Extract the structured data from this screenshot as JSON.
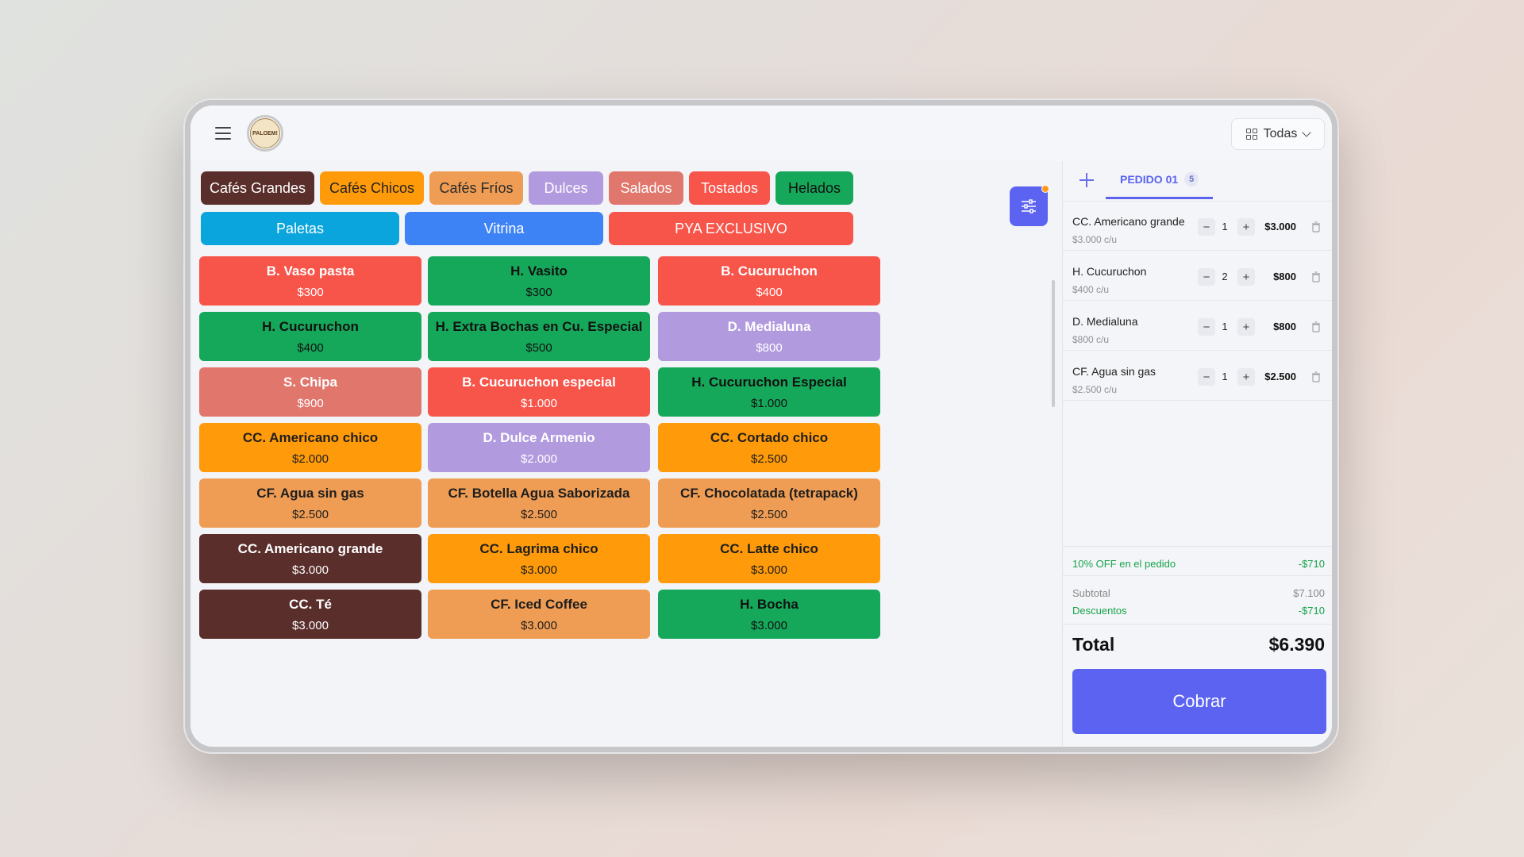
{
  "header": {
    "logo_text": "PALOEM!",
    "view_select_value": "Todas"
  },
  "categories": [
    {
      "label": "Cafés Grandes",
      "bg": "#5a2e2b",
      "fg": "#ffffff"
    },
    {
      "label": "Cafés Chicos",
      "bg": "#ff9a0a",
      "fg": "#222222"
    },
    {
      "label": "Cafés Fríos",
      "bg": "#ef9d54",
      "fg": "#2a2a2a"
    },
    {
      "label": "Dulces",
      "bg": "#b29ade",
      "fg": "#ffffff"
    },
    {
      "label": "Salados",
      "bg": "#e1766c",
      "fg": "#ffffff"
    },
    {
      "label": "Tostados",
      "bg": "#f7544a",
      "fg": "#ffffff"
    },
    {
      "label": "Helados",
      "bg": "#16a85a",
      "fg": "#111111"
    },
    {
      "label": "Paletas",
      "bg": "#0aa5dc",
      "fg": "#ffffff"
    },
    {
      "label": "Vitrina",
      "bg": "#3d83f5",
      "fg": "#ffffff"
    },
    {
      "label": "PYA EXCLUSIVO",
      "bg": "#f7544a",
      "fg": "#ffffff"
    }
  ],
  "products": [
    {
      "name": "B. Vaso pasta",
      "price": "$300",
      "bg": "#f7544a",
      "fg": "#ffffff"
    },
    {
      "name": "H. Vasito",
      "price": "$300",
      "bg": "#16a85a",
      "fg": "#111111"
    },
    {
      "name": "B. Cucuruchon",
      "price": "$400",
      "bg": "#f7544a",
      "fg": "#ffffff"
    },
    {
      "name": "H. Cucuruchon",
      "price": "$400",
      "bg": "#16a85a",
      "fg": "#111111"
    },
    {
      "name": "H. Extra Bochas en Cu. Especial",
      "price": "$500",
      "bg": "#16a85a",
      "fg": "#111111"
    },
    {
      "name": "D. Medialuna",
      "price": "$800",
      "bg": "#b29ade",
      "fg": "#ffffff"
    },
    {
      "name": "S. Chipa",
      "price": "$900",
      "bg": "#e1766c",
      "fg": "#ffffff"
    },
    {
      "name": "B. Cucuruchon especial",
      "price": "$1.000",
      "bg": "#f7544a",
      "fg": "#ffffff"
    },
    {
      "name": "H. Cucuruchon Especial",
      "price": "$1.000",
      "bg": "#16a85a",
      "fg": "#111111"
    },
    {
      "name": "CC. Americano chico",
      "price": "$2.000",
      "bg": "#ff9a0a",
      "fg": "#1e1e1e"
    },
    {
      "name": "D. Dulce Armenio",
      "price": "$2.000",
      "bg": "#b29ade",
      "fg": "#ffffff"
    },
    {
      "name": "CC. Cortado chico",
      "price": "$2.500",
      "bg": "#ff9a0a",
      "fg": "#1e1e1e"
    },
    {
      "name": "CF. Agua sin gas",
      "price": "$2.500",
      "bg": "#ef9d54",
      "fg": "#1e1e1e"
    },
    {
      "name": "CF. Botella Agua Saborizada",
      "price": "$2.500",
      "bg": "#ef9d54",
      "fg": "#1e1e1e"
    },
    {
      "name": "CF. Chocolatada (tetrapack)",
      "price": "$2.500",
      "bg": "#ef9d54",
      "fg": "#1e1e1e"
    },
    {
      "name": "CC. Americano grande",
      "price": "$3.000",
      "bg": "#5a2e2b",
      "fg": "#ffffff"
    },
    {
      "name": "CC. Lagrima chico",
      "price": "$3.000",
      "bg": "#ff9a0a",
      "fg": "#1e1e1e"
    },
    {
      "name": "CC. Latte chico",
      "price": "$3.000",
      "bg": "#ff9a0a",
      "fg": "#1e1e1e"
    },
    {
      "name": "CC. Té",
      "price": "$3.000",
      "bg": "#5a2e2b",
      "fg": "#ffffff"
    },
    {
      "name": "CF. Iced Coffee",
      "price": "$3.000",
      "bg": "#ef9d54",
      "fg": "#1e1e1e"
    },
    {
      "name": "H. Bocha",
      "price": "$3.000",
      "bg": "#16a85a",
      "fg": "#111111"
    }
  ],
  "order": {
    "tab_label": "PEDIDO 01",
    "tab_badge": "5",
    "items": [
      {
        "name": "CC. Americano grande",
        "unit": "$3.000 c/u",
        "qty": "1",
        "total": "$3.000"
      },
      {
        "name": "H. Cucuruchon",
        "unit": "$400 c/u",
        "qty": "2",
        "total": "$800"
      },
      {
        "name": "D. Medialuna",
        "unit": "$800 c/u",
        "qty": "1",
        "total": "$800"
      },
      {
        "name": "CF. Agua sin gas",
        "unit": "$2.500 c/u",
        "qty": "1",
        "total": "$2.500"
      }
    ],
    "promo_label": "10% OFF en el pedido",
    "promo_value": "-$710",
    "subtotal_label": "Subtotal",
    "subtotal_value": "$7.100",
    "discounts_label": "Descuentos",
    "discounts_value": "-$710",
    "total_label": "Total",
    "total_value": "$6.390",
    "charge_label": "Cobrar"
  },
  "colors": {
    "accent": "#5b63f0",
    "discount_green": "#16a34a"
  }
}
